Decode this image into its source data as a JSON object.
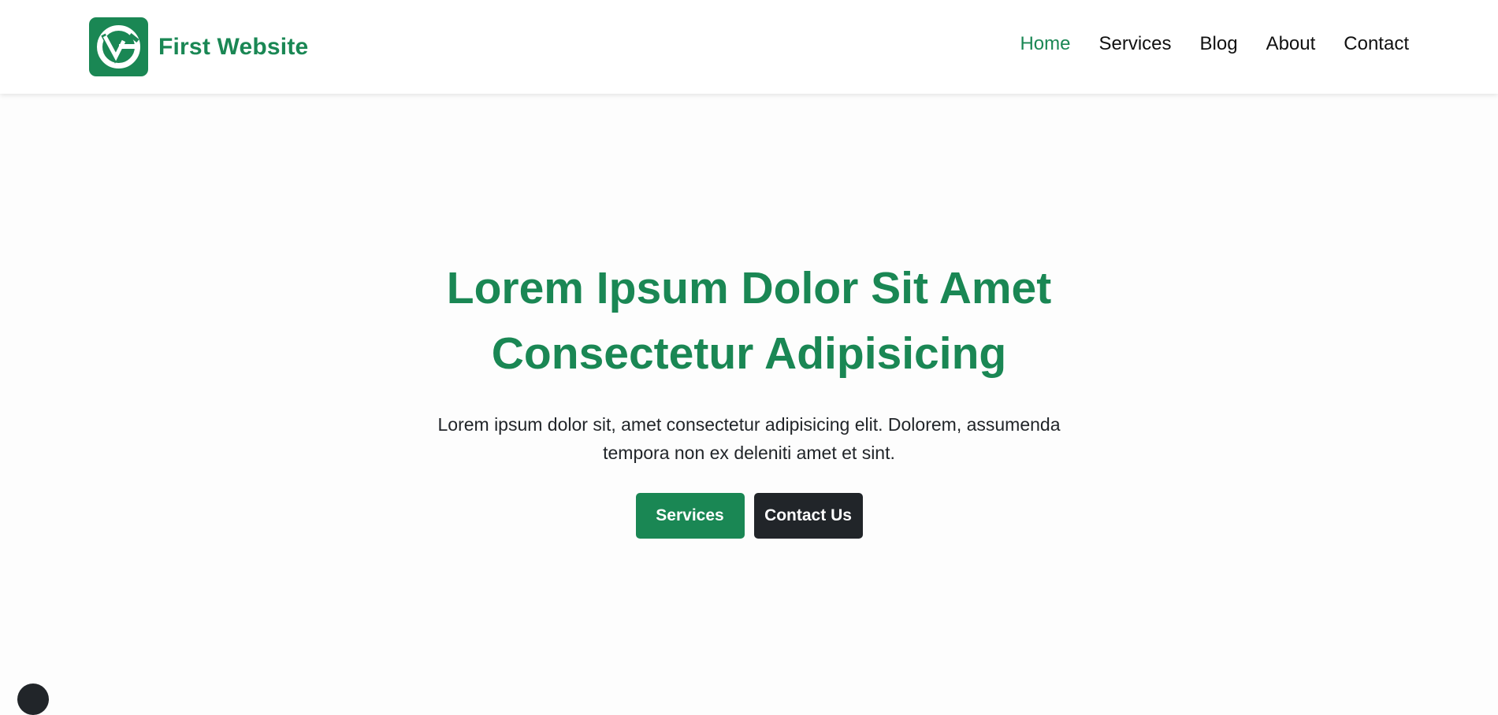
{
  "brand": {
    "name": "First Website",
    "logo_icon": "brand-logo-icon",
    "color": "#1a8754"
  },
  "nav": {
    "items": [
      {
        "label": "Home",
        "active": true
      },
      {
        "label": "Services",
        "active": false
      },
      {
        "label": "Blog",
        "active": false
      },
      {
        "label": "About",
        "active": false
      },
      {
        "label": "Contact",
        "active": false
      }
    ]
  },
  "hero": {
    "title": "Lorem Ipsum Dolor Sit Amet Consectetur Adipisicing",
    "text": "Lorem ipsum dolor sit, amet consectetur adipisicing elit. Dolorem, assumenda tempora non ex deleniti amet et sint.",
    "primary_button": "Services",
    "secondary_button": "Contact Us"
  },
  "colors": {
    "accent": "#1a8754",
    "dark": "#212529",
    "background": "#fdfdfd"
  }
}
